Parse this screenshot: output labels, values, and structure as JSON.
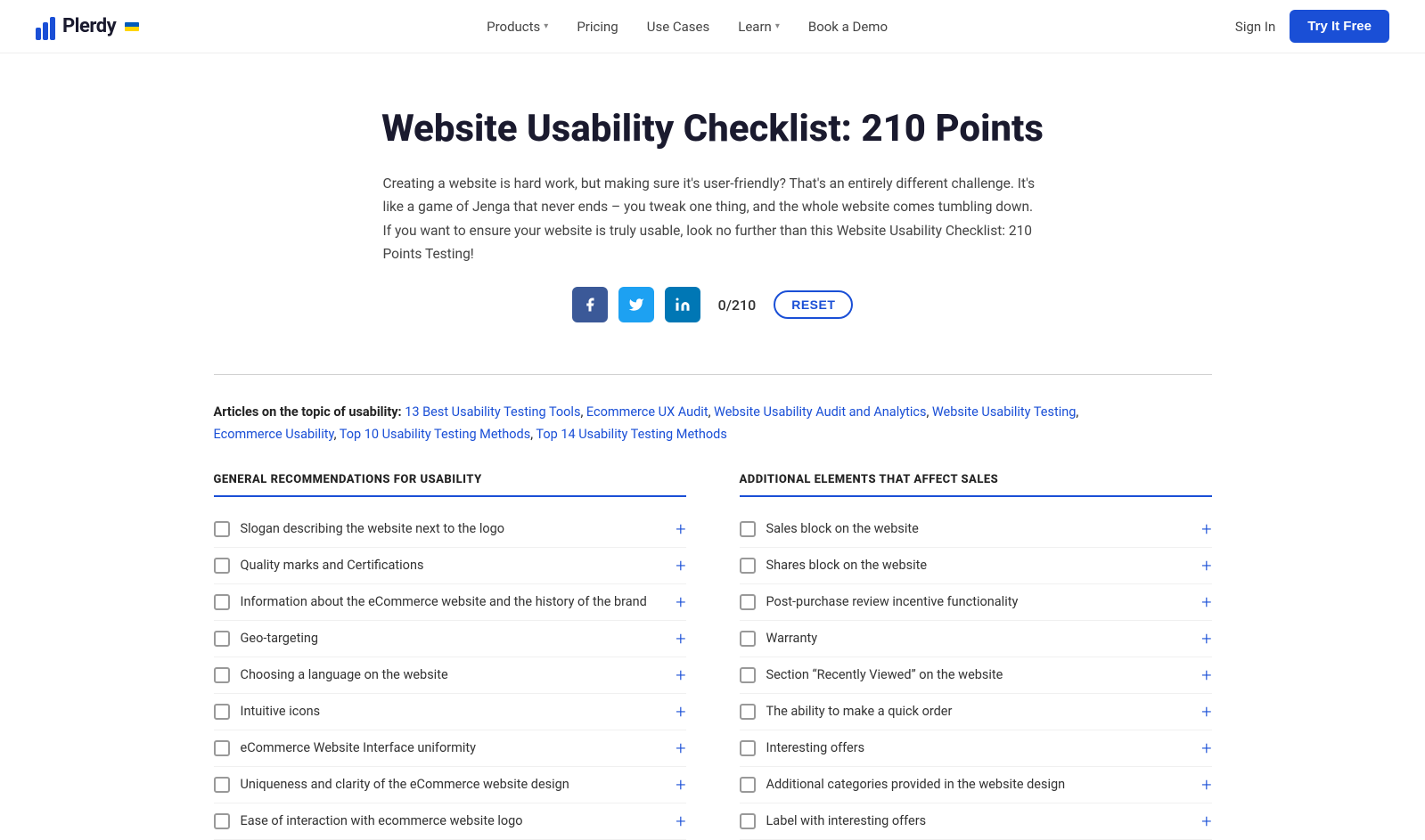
{
  "header": {
    "logo_text": "Plerdy",
    "nav_items": [
      {
        "label": "Products",
        "has_dropdown": true
      },
      {
        "label": "Pricing",
        "has_dropdown": false
      },
      {
        "label": "Use Cases",
        "has_dropdown": false
      },
      {
        "label": "Learn",
        "has_dropdown": true
      },
      {
        "label": "Book a Demo",
        "has_dropdown": false
      }
    ],
    "sign_in_label": "Sign In",
    "try_free_label": "Try It Free"
  },
  "hero": {
    "title": "Website Usability Checklist: 210 Points",
    "description": "Creating a website is hard work, but making sure it's user-friendly? That's an entirely different challenge. It's like a game of Jenga that never ends – you tweak one thing, and the whole website comes tumbling down. If you want to ensure your website is truly usable, look no further than this Website Usability Checklist: 210 Points Testing!",
    "counter": "0/210",
    "reset_label": "RESET"
  },
  "social": {
    "facebook_icon": "f",
    "twitter_icon": "t",
    "linkedin_icon": "in"
  },
  "articles": {
    "label": "Articles on the topic of usability:",
    "links": [
      "13 Best Usability Testing Tools",
      "Ecommerce UX Audit",
      "Website Usability Audit and Analytics",
      "Website Usability Testing",
      "Ecommerce Usability",
      "Top 10 Usability Testing Methods",
      "Top 14 Usability Testing Methods"
    ]
  },
  "left_section": {
    "title": "GENERAL RECOMMENDATIONS FOR USABILITY",
    "items": [
      "Slogan describing the website next to the logo",
      "Quality marks and Certifications",
      "Information about the eCommerce website and the history of the brand",
      "Geo-targeting",
      "Choosing a language on the website",
      "Intuitive icons",
      "eCommerce Website Interface uniformity",
      "Uniqueness and clarity of the eCommerce website design",
      "Ease of interaction with ecommerce website logo"
    ]
  },
  "right_section": {
    "title": "ADDITIONAL ELEMENTS THAT AFFECT SALES",
    "items": [
      "Sales block on the website",
      "Shares block on the website",
      "Post-purchase review incentive functionality",
      "Warranty",
      "Section “Recently Viewed” on the website",
      "The ability to make a quick order",
      "Interesting offers",
      "Additional categories provided in the website design",
      "Label with interesting offers"
    ]
  }
}
